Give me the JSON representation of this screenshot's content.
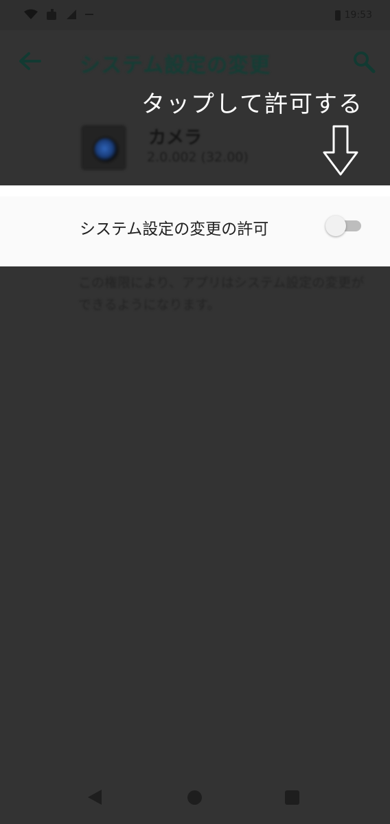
{
  "status_bar": {
    "time": "19:53",
    "icons": [
      "wifi-icon",
      "notification-icon",
      "signal-icon",
      "battery-icon"
    ]
  },
  "app_bar": {
    "title": "システム設定の変更",
    "back_icon": "arrow-left-icon",
    "search_icon": "search-icon"
  },
  "annotation": {
    "text": "タップして許可する",
    "arrow_icon": "down-arrow-icon"
  },
  "app_info": {
    "name": "カメラ",
    "version": "2.0.002 (32.00)"
  },
  "permission": {
    "label": "システム設定の変更の許可",
    "toggle_on": false
  },
  "description": "この権限により、アプリはシステム設定の変更ができるようになります。",
  "nav_bar": {
    "buttons": [
      "back",
      "home",
      "recents"
    ]
  },
  "colors": {
    "dim_background": "#333333",
    "panel": "#fafafa",
    "accent_dark_teal": "#143d35",
    "annotation_text": "#ffffff"
  }
}
